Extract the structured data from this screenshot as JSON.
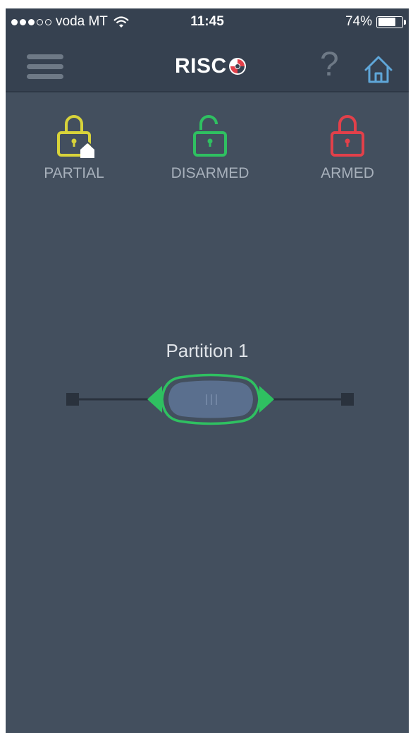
{
  "status_bar": {
    "carrier": "voda MT",
    "time": "11:45",
    "battery": "74%",
    "battery_level": 0.74,
    "signal_bars_filled": 3,
    "signal_bars_total": 5
  },
  "navbar": {
    "logo": "RISC",
    "help": "?"
  },
  "states": [
    {
      "label": "PARTIAL",
      "color": "#d8d33a"
    },
    {
      "label": "DISARMED",
      "color": "#2fc061"
    },
    {
      "label": "ARMED",
      "color": "#e2404a"
    }
  ],
  "partition": {
    "name": "Partition 1",
    "state": "DISARMED",
    "accent_color": "#2fc061"
  },
  "colors": {
    "background": "#434f5e",
    "bar": "#364150"
  }
}
